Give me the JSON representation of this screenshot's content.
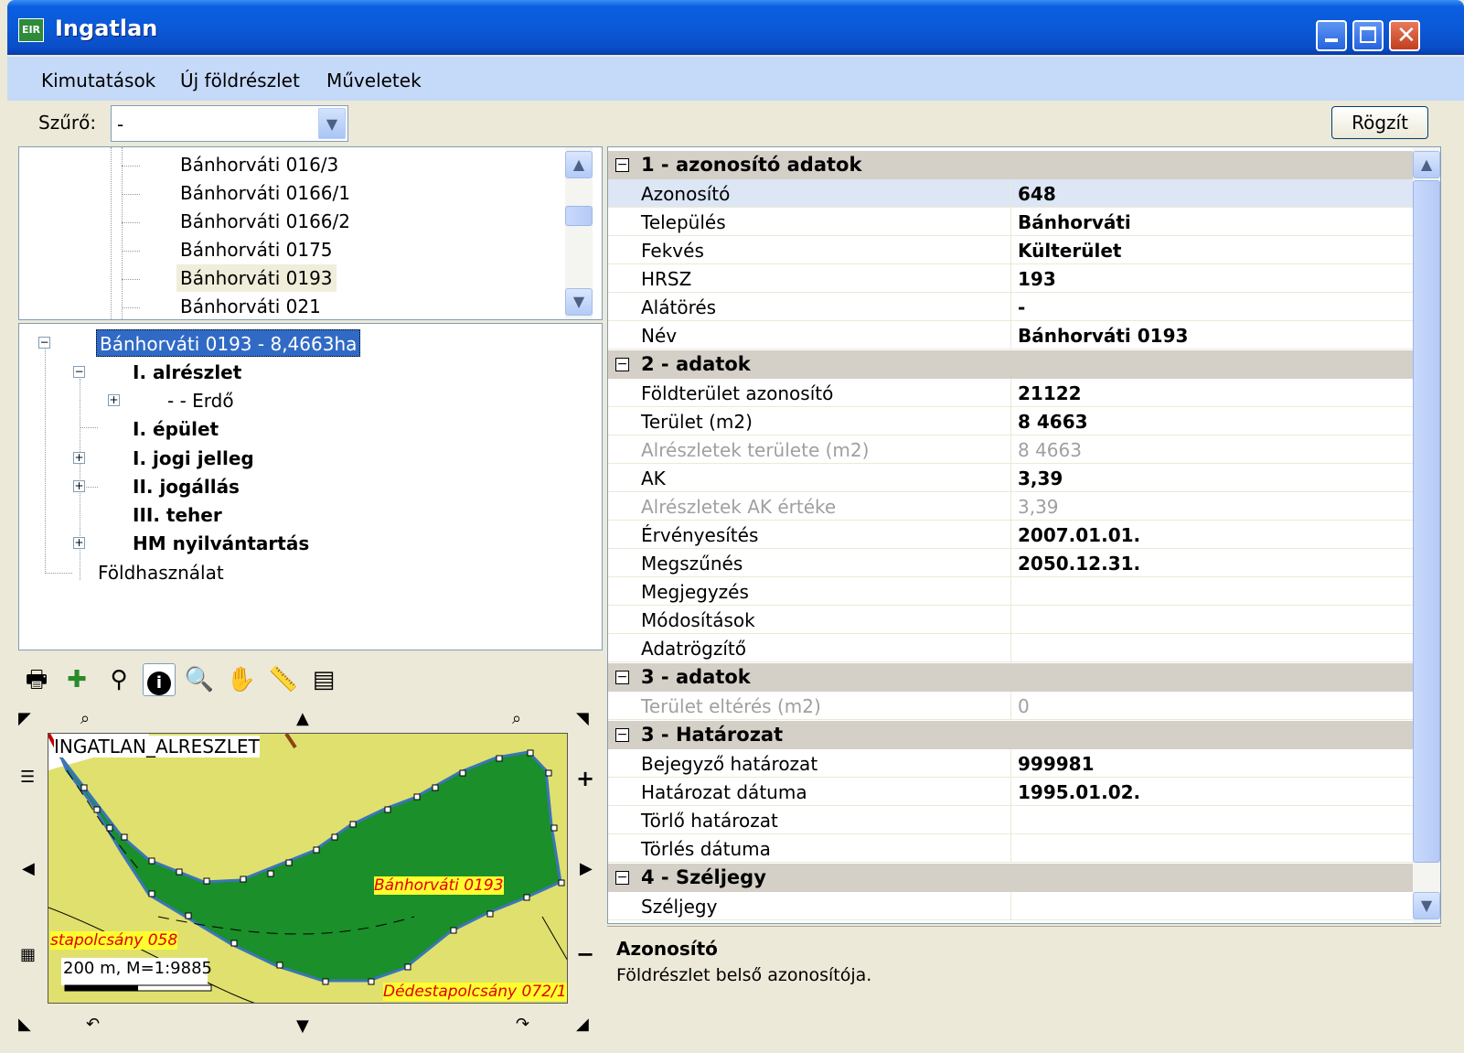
{
  "window": {
    "title": "Ingatlan",
    "icon_text": "EIR"
  },
  "menu": [
    "Kimutatások",
    "Új földrészlet",
    "Műveletek"
  ],
  "filter": {
    "label": "Szűrő:",
    "value": "-"
  },
  "save_button": "Rögzít",
  "parcel_list": [
    "Bánhorváti 016/3",
    "Bánhorváti 0166/1",
    "Bánhorváti 0166/2",
    "Bánhorváti 0175",
    "Bánhorváti 0193",
    "Bánhorváti 021"
  ],
  "tree": {
    "root": "Bánhorváti 0193 - 8,4663ha",
    "n1": "I. alrészlet",
    "n1a": "- - Erdő",
    "n2": "I. épület",
    "n3": "I. jogi jelleg",
    "n4": "II. jogállás",
    "n5": "III. teher",
    "n6": "HM nyilvántartás",
    "n7": "Földhasználat"
  },
  "map": {
    "layer_label": "INGATLAN_ALRESZLET",
    "scale": "200 m, M=1:9885",
    "labels": {
      "main": "Bánhorváti 0193",
      "left": "stapolcsány 058",
      "bottom": "Dédestapolcsány 072/1"
    }
  },
  "properties": {
    "c1": "1 - azonosító adatok",
    "c2": "2 - adatok",
    "c3": "3 - adatok",
    "c4": "3 - Határozat",
    "c5": "4 - Széljegy",
    "r1": {
      "k": "Azonosító",
      "v": "648"
    },
    "r2": {
      "k": "Település",
      "v": "Bánhorváti"
    },
    "r3": {
      "k": "Fekvés",
      "v": "Külterület"
    },
    "r4": {
      "k": "HRSZ",
      "v": "193"
    },
    "r5": {
      "k": "Alátörés",
      "v": "-"
    },
    "r6": {
      "k": "Név",
      "v": "Bánhorváti 0193"
    },
    "r7": {
      "k": "Földterület azonosító",
      "v": "21122"
    },
    "r8": {
      "k": "Terület (m2)",
      "v": "8 4663"
    },
    "r9": {
      "k": "Alrészletek területe (m2)",
      "v": "8 4663"
    },
    "r10": {
      "k": "AK",
      "v": "3,39"
    },
    "r11": {
      "k": "Alrészletek AK értéke",
      "v": "3,39"
    },
    "r12": {
      "k": "Érvényesítés",
      "v": "2007.01.01."
    },
    "r13": {
      "k": "Megszűnés",
      "v": "2050.12.31."
    },
    "r14": {
      "k": "Megjegyzés",
      "v": ""
    },
    "r15": {
      "k": "Módosítások",
      "v": ""
    },
    "r16": {
      "k": "Adatrögzítő",
      "v": ""
    },
    "r17": {
      "k": "Terület eltérés (m2)",
      "v": "0"
    },
    "r18": {
      "k": "Bejegyző határozat",
      "v": "999981"
    },
    "r19": {
      "k": "Határozat dátuma",
      "v": "1995.01.02."
    },
    "r20": {
      "k": "Törlő határozat",
      "v": ""
    },
    "r21": {
      "k": "Törlés dátuma",
      "v": ""
    },
    "r22": {
      "k": "Széljegy",
      "v": ""
    }
  },
  "description": {
    "title": "Azonosító",
    "text": "Földrészlet belső azonosítója."
  },
  "colors": {
    "titlebar": "#0a5fe0",
    "selection": "#316ac5",
    "parcel_fill": "#1a8f2a",
    "map_bg": "#e0e06e",
    "label_red": "#e00000"
  }
}
